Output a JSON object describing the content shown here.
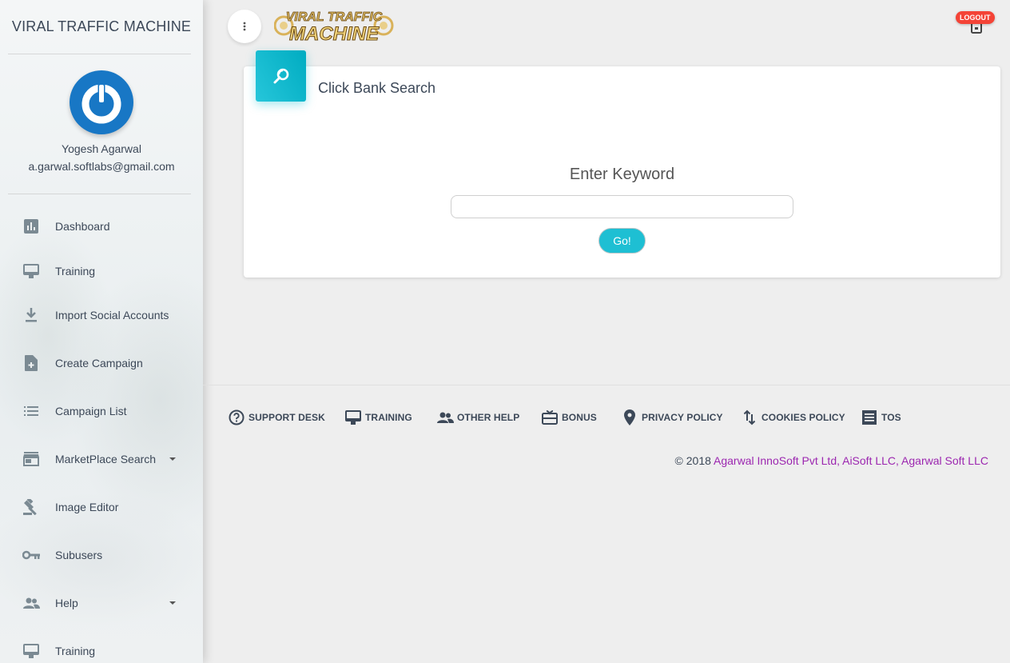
{
  "sidebar": {
    "brand": "VIRAL TRAFFIC MACHINE",
    "user": {
      "name": "Yogesh Agarwal",
      "email": "a.garwal.softlabs@gmail.com"
    },
    "items": [
      {
        "label": "Dashboard",
        "icon": "bar-chart-icon"
      },
      {
        "label": "Training",
        "icon": "monitor-icon"
      },
      {
        "label": "Import Social Accounts",
        "icon": "download-icon"
      },
      {
        "label": "Create Campaign",
        "icon": "add-file-icon"
      },
      {
        "label": "Campaign List",
        "icon": "list-icon"
      },
      {
        "label": "MarketPlace Search",
        "icon": "store-icon",
        "has_caret": true
      },
      {
        "label": "Image Editor",
        "icon": "gavel-icon"
      },
      {
        "label": "Subusers",
        "icon": "key-icon"
      },
      {
        "label": "Help",
        "icon": "people-icon",
        "has_caret": true
      },
      {
        "label": "Training",
        "icon": "monitor-icon"
      }
    ]
  },
  "topbar": {
    "logo_line1": "VIRAL TRAFFIC",
    "logo_line2": "MACHINE",
    "logout": "LOGOUT"
  },
  "card": {
    "title": "Click Bank Search",
    "keyword_label": "Enter Keyword",
    "keyword_value": "",
    "keyword_placeholder": "",
    "go_label": "Go!"
  },
  "footer": {
    "links": [
      {
        "label": "SUPPORT DESK",
        "icon": "help-circle-icon"
      },
      {
        "label": "TRAINING",
        "icon": "monitor-icon"
      },
      {
        "label": "OTHER HELP",
        "icon": "people-icon"
      },
      {
        "label": "BONUS",
        "icon": "gift-card-icon"
      },
      {
        "label": "PRIVACY POLICY",
        "icon": "location-pin-icon"
      },
      {
        "label": "COOKIES POLICY",
        "icon": "swap-vert-icon"
      },
      {
        "label": "TOS",
        "icon": "receipt-icon"
      }
    ],
    "copyright_prefix": "© 2018 ",
    "companies": "Agarwal InnoSoft Pvt Ltd, AiSoft LLC, Agarwal Soft LLC"
  },
  "colors": {
    "accent": "#00bcd4",
    "logout": "#f44336",
    "link": "#9c27b0",
    "avatar": "#1877c5"
  }
}
